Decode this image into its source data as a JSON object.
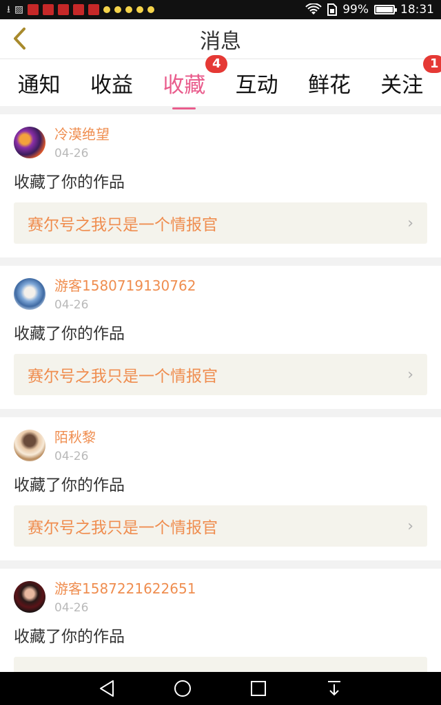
{
  "status_bar": {
    "battery": "99%",
    "battery_level": 0.99,
    "time": "18:31"
  },
  "header": {
    "title": "消息"
  },
  "tabs": [
    {
      "label": "通知",
      "badge": ""
    },
    {
      "label": "收益",
      "badge": ""
    },
    {
      "label": "收藏",
      "badge": "4"
    },
    {
      "label": "互动",
      "badge": ""
    },
    {
      "label": "鲜花",
      "badge": ""
    },
    {
      "label": "关注",
      "badge": "1"
    }
  ],
  "active_tab": "收藏",
  "colors": {
    "accent": "#e95c8c",
    "username": "#ef8d4f",
    "badge": "#e53935",
    "back_icon": "#a88a2c"
  },
  "feed": [
    {
      "username": "冷漠绝望",
      "date": "04-26",
      "action": "收藏了你的作品",
      "work": "赛尔号之我只是一个情报官"
    },
    {
      "username": "游客1580719130762",
      "date": "04-26",
      "action": "收藏了你的作品",
      "work": "赛尔号之我只是一个情报官"
    },
    {
      "username": "陌秋黎",
      "date": "04-26",
      "action": "收藏了你的作品",
      "work": "赛尔号之我只是一个情报官"
    },
    {
      "username": "游客1587221622651",
      "date": "04-26",
      "action": "收藏了你的作品",
      "work": ""
    }
  ]
}
